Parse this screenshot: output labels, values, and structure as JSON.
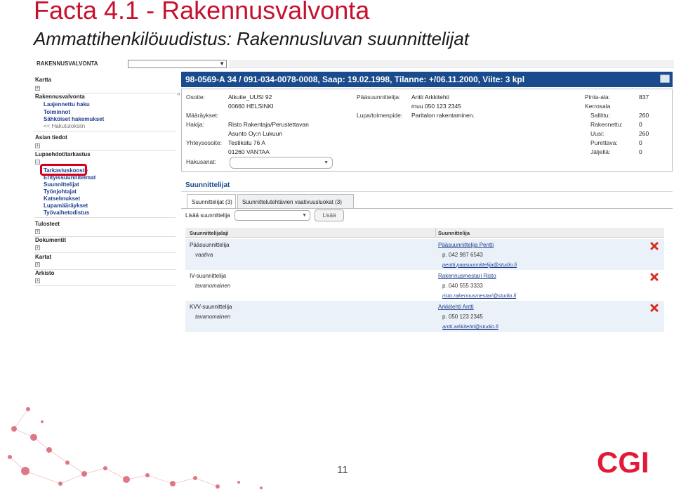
{
  "slide": {
    "title": "Facta 4.1 - Rakennusvalvonta",
    "subtitle": "Ammattihenkilöuudistus: Rakennusluvan suunnittelijat",
    "page_number": "11",
    "logo_text": "CGI"
  },
  "app": {
    "name": "RAKENNUSVALVONTA"
  },
  "sidebar": {
    "kartta": "Kartta",
    "rakennusvalvonta": "Rakennusvalvonta",
    "rv_items": [
      "Laajennettu haku",
      "Toiminnot",
      "Sähköiset hakemukset",
      "<< Hakutuloksiin"
    ],
    "asian_tiedot": "Asian tiedot",
    "lupaehdot": "Lupaehdot/tarkastus",
    "lupa_items": [
      "Tarkastuskooste",
      "Erityissuunnitelmat",
      "Suunnittelijat",
      "Työnjohtajat",
      "Katselmukset",
      "Lupamääräykset",
      "Työvaihetodistus"
    ],
    "tulosteet": "Tulosteet",
    "dokumentit": "Dokumentit",
    "kartat": "Kartat",
    "arkisto": "Arkisto"
  },
  "case": {
    "header": "98-0569-A 34 / 091-034-0078-0008, Saap: 19.02.1998, Tilanne: +/06.11.2000, Viite: 3 kpl",
    "osoite_label": "Osoite:",
    "osoite_1": "Alkutie_UUSI 92",
    "osoite_2": "00660 HELSINKI",
    "maaraykset_label": "Määräykset:",
    "hakija_label": "Hakija:",
    "hakija_1": "Risto Rakentaja/Perustettavan",
    "hakija_2": "Asunto Oy:n Lukuun",
    "yhteys_label": "Yhteysosoite:",
    "yhteys_1": "Testikatu 76 A",
    "yhteys_2": "01260 VANTAA",
    "hakusanat_label": "Hakusanat:",
    "paasuunnittelija_label": "Pääsuunnittelija:",
    "paasuunnittelija_1": "Antti Arkkitehti",
    "paasuunnittelija_2": "muu 050 123 2345",
    "lupa_label": "Lupa/toimenpide:",
    "lupa_value": "Paritalon rakentaminen.",
    "pinta_label": "Pinta-ala:",
    "pinta_value": "837",
    "kerrosala_label": "Kerrosala",
    "sallittu_label": "Sallittu:",
    "sallittu_value": "260",
    "rakennettu_label": "Rakennettu:",
    "rakennettu_value": "0",
    "uusi_label": "Uusi:",
    "uusi_value": "260",
    "purettava_label": "Purettava:",
    "purettava_value": "0",
    "jaljella_label": "Jäljellä:",
    "jaljella_value": "0"
  },
  "section": {
    "title": "Suunnittelijat",
    "tabs": [
      "Suunnittelijat (3)",
      "Suunnittelutehtävien vaativuusluokat (3)"
    ],
    "add_label": "Lisää suunnittelija",
    "add_button": "Lisää",
    "columns": [
      "Suunnittelijalaji",
      "Suunnittelija"
    ],
    "rows": [
      {
        "role": "Pääsuunnittelija",
        "requirement": "vaativa",
        "name": "Pääsuunnittelija Pentti",
        "phone": "p. 042 987 6543",
        "email": "pentti.paasuunnittelija@studio.fi"
      },
      {
        "role": "IV-suunnittelija",
        "requirement": "tavanomainen",
        "name": "Rakennusmestari Risto",
        "phone": "p. 040 555 3333",
        "email": "risto.rakennusmestari@studio.fi"
      },
      {
        "role": "KVV-suunnittelija",
        "requirement": "tavanomainen",
        "name": "Arkkitehti Antti",
        "phone": "p. 050 123 2345",
        "email": "antti.arkkitehti@studio.fi"
      }
    ]
  },
  "colors": {
    "accent_red": "#c8102e",
    "header_blue": "#1a4b8c",
    "link_blue": "#1f3f8f"
  }
}
